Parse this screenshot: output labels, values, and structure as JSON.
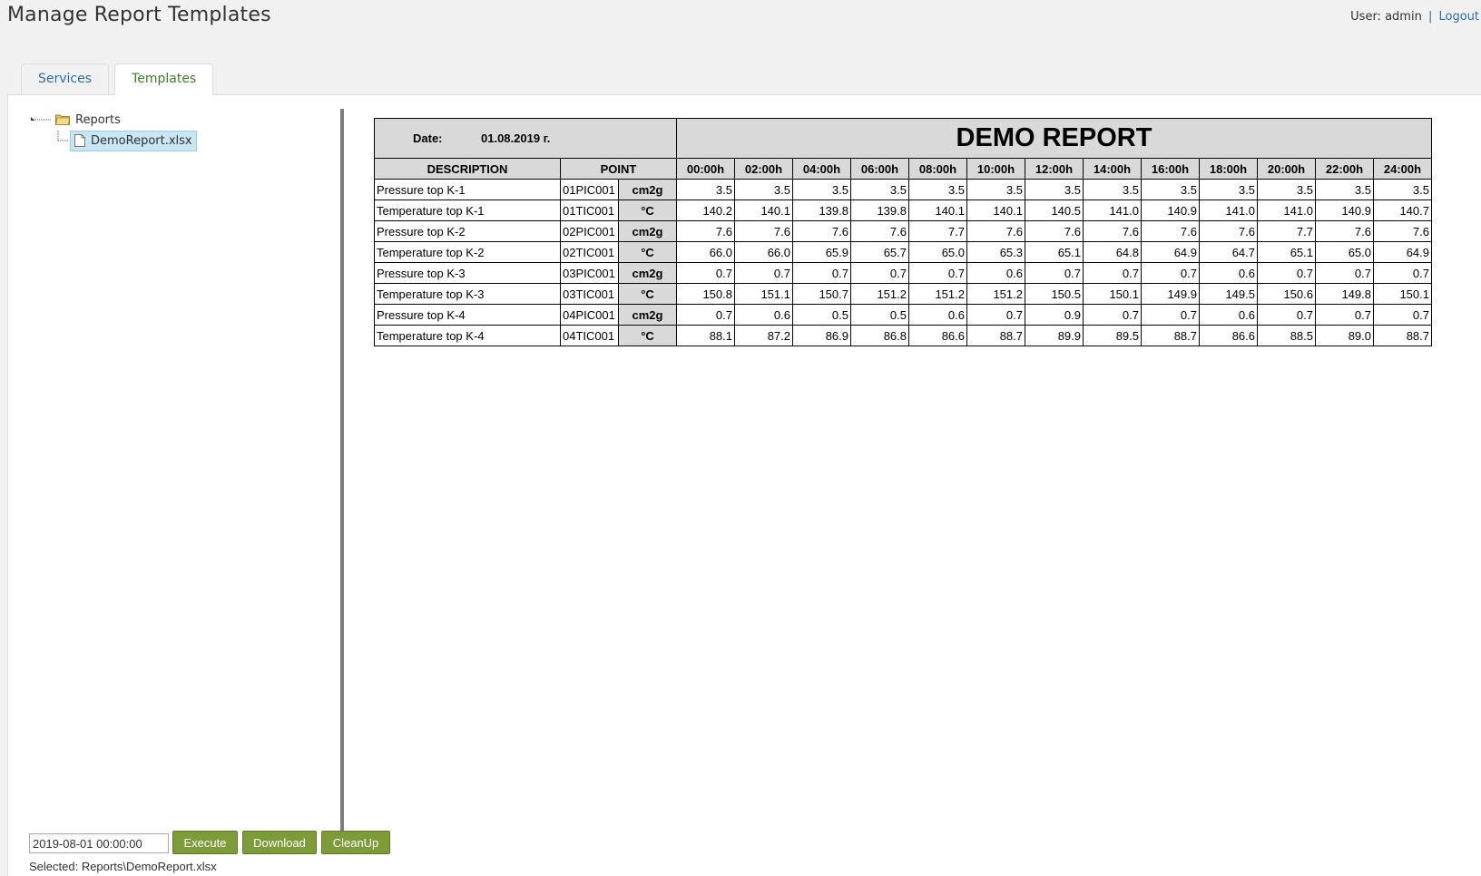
{
  "header": {
    "title": "Manage Report Templates",
    "user_label": "User: admin",
    "separator": "|",
    "logout_label": "Logout"
  },
  "tabs": [
    {
      "label": "Services",
      "active": false
    },
    {
      "label": "Templates",
      "active": true
    }
  ],
  "tree": {
    "root_label": "Reports",
    "root_icon": "folder-icon",
    "file_label": "DemoReport.xlsx",
    "file_icon": "file-icon"
  },
  "report": {
    "title": "DEMO REPORT",
    "date_label": "Date:",
    "date_value": "01.08.2019 г.",
    "columns": {
      "description": "DESCRIPTION",
      "point": "POINT",
      "hours": [
        "00:00h",
        "02:00h",
        "04:00h",
        "06:00h",
        "08:00h",
        "10:00h",
        "12:00h",
        "14:00h",
        "16:00h",
        "18:00h",
        "20:00h",
        "22:00h",
        "24:00h"
      ]
    },
    "rows": [
      {
        "description": "Pressure top K-1",
        "point": "01PIC001",
        "unit": "cm2g",
        "values": [
          "3.5",
          "3.5",
          "3.5",
          "3.5",
          "3.5",
          "3.5",
          "3.5",
          "3.5",
          "3.5",
          "3.5",
          "3.5",
          "3.5",
          "3.5"
        ]
      },
      {
        "description": "Temperature top K-1",
        "point": "01TIC001",
        "unit": "°C",
        "values": [
          "140.2",
          "140.1",
          "139.8",
          "139.8",
          "140.1",
          "140.1",
          "140.5",
          "141.0",
          "140.9",
          "141.0",
          "141.0",
          "140.9",
          "140.7"
        ]
      },
      {
        "description": "Pressure top K-2",
        "point": "02PIC001",
        "unit": "cm2g",
        "values": [
          "7.6",
          "7.6",
          "7.6",
          "7.6",
          "7.7",
          "7.6",
          "7.6",
          "7.6",
          "7.6",
          "7.6",
          "7.7",
          "7.6",
          "7.6"
        ]
      },
      {
        "description": "Temperature top K-2",
        "point": "02TIC001",
        "unit": "°C",
        "values": [
          "66.0",
          "66.0",
          "65.9",
          "65.7",
          "65.0",
          "65.3",
          "65.1",
          "64.8",
          "64.9",
          "64.7",
          "65.1",
          "65.0",
          "64.9"
        ]
      },
      {
        "description": "Pressure top K-3",
        "point": "03PIC001",
        "unit": "cm2g",
        "values": [
          "0.7",
          "0.7",
          "0.7",
          "0.7",
          "0.7",
          "0.6",
          "0.7",
          "0.7",
          "0.7",
          "0.6",
          "0.7",
          "0.7",
          "0.7"
        ]
      },
      {
        "description": "Temperature top K-3",
        "point": "03TIC001",
        "unit": "°C",
        "values": [
          "150.8",
          "151.1",
          "150.7",
          "151.2",
          "151.2",
          "151.2",
          "150.5",
          "150.1",
          "149.9",
          "149.5",
          "150.6",
          "149.8",
          "150.1"
        ]
      },
      {
        "description": "Pressure top K-4",
        "point": "04PIC001",
        "unit": "cm2g",
        "values": [
          "0.7",
          "0.6",
          "0.5",
          "0.5",
          "0.6",
          "0.7",
          "0.9",
          "0.7",
          "0.7",
          "0.6",
          "0.7",
          "0.7",
          "0.7"
        ]
      },
      {
        "description": "Temperature top K-4",
        "point": "04TIC001",
        "unit": "°C",
        "values": [
          "88.1",
          "87.2",
          "86.9",
          "86.8",
          "86.6",
          "88.7",
          "89.9",
          "89.5",
          "88.7",
          "86.6",
          "88.5",
          "89.0",
          "88.7"
        ]
      }
    ]
  },
  "controls": {
    "date_input_value": "2019-08-01 00:00:00",
    "execute_label": "Execute",
    "download_label": "Download",
    "cleanup_label": "CleanUp",
    "selected_text": "Selected: Reports\\DemoReport.xlsx"
  },
  "colors": {
    "button_bg": "#7e9b3a",
    "active_tab_text": "#3f7c2a",
    "link": "#2a6fa8",
    "selection_bg": "#c9e6f5"
  }
}
